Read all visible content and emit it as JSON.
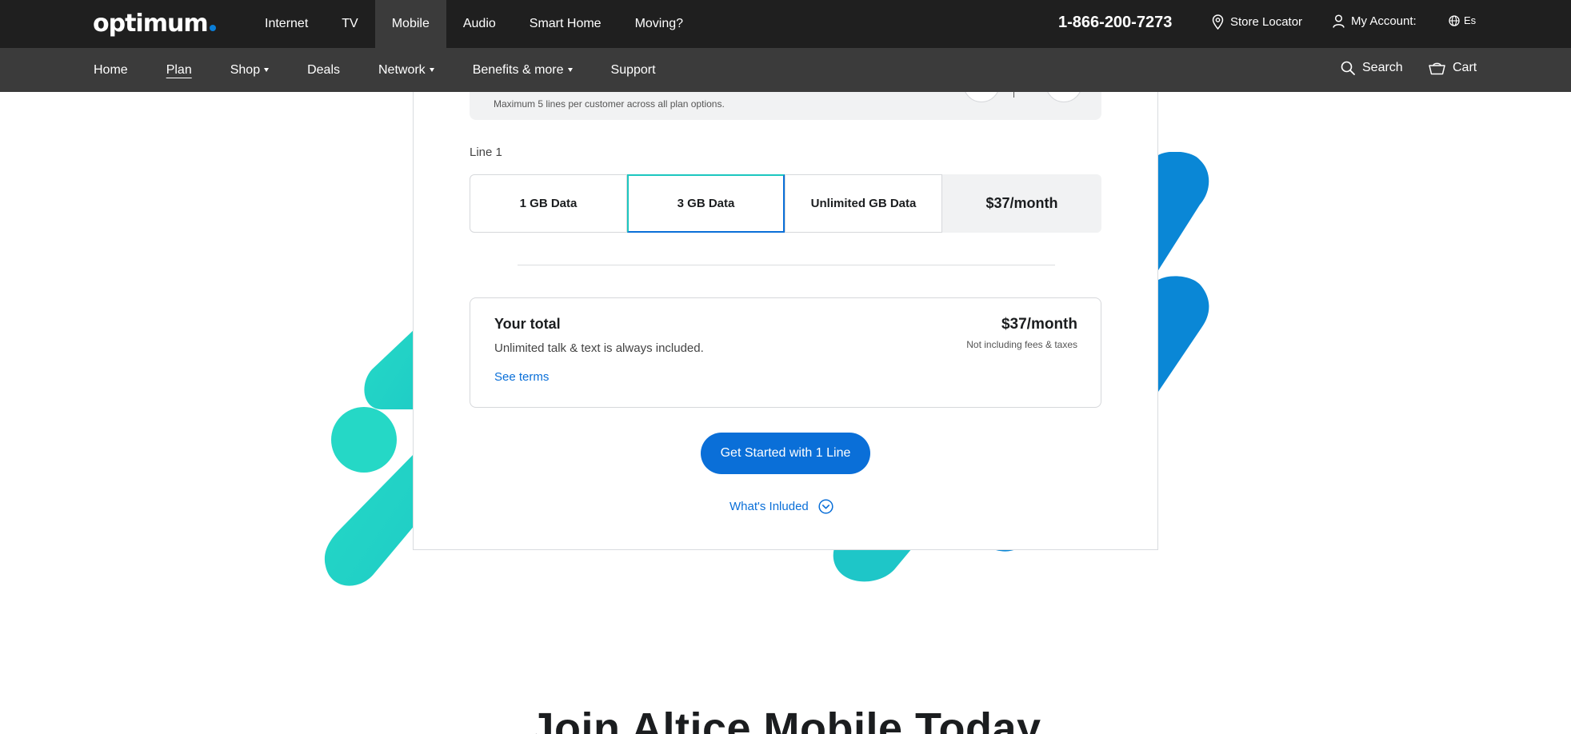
{
  "brand": {
    "logo_text": "optimum",
    "accent": "#0a7ed8"
  },
  "topnav": {
    "items": [
      {
        "label": "Internet"
      },
      {
        "label": "TV"
      },
      {
        "label": "Mobile"
      },
      {
        "label": "Audio"
      },
      {
        "label": "Smart Home"
      },
      {
        "label": "Moving?"
      }
    ],
    "active": "Mobile",
    "phone": "1-866-200-7273",
    "store_locator": "Store Locator",
    "my_account": "My Account:",
    "language": "Es"
  },
  "subnav": {
    "items": [
      {
        "label": "Home"
      },
      {
        "label": "Plan"
      },
      {
        "label": "Shop"
      },
      {
        "label": "Deals"
      },
      {
        "label": "Network"
      },
      {
        "label": "Benefits & more"
      },
      {
        "label": "Support"
      }
    ],
    "current": "Plan",
    "search": "Search",
    "cart": "Cart"
  },
  "plan_builder": {
    "lines_note": "Maximum 5 lines per customer across all plan options.",
    "line_label": "Line 1",
    "options": [
      {
        "label": "1 GB Data",
        "selected": false
      },
      {
        "label": "3 GB Data",
        "selected": true
      },
      {
        "label": "Unlimited GB Data",
        "selected": false
      }
    ],
    "line_price": "$37/month",
    "total": {
      "title": "Your total",
      "subtitle": "Unlimited talk & text is always included.",
      "terms_link": "See terms",
      "price": "$37/month",
      "note": "Not including fees & taxes"
    },
    "cta_label": "Get Started with 1 Line",
    "included_label": "What's Inluded"
  },
  "section_heading": "Join Altice Mobile Today",
  "colors": {
    "top_bar": "#1f1f1f",
    "sub_bar": "#3b3b3b",
    "primary_blue": "#0a6fd8",
    "teal": "#22d3c5"
  },
  "icons": {
    "location": "map-pin-icon",
    "account": "user-icon",
    "language": "globe-icon",
    "search": "search-icon",
    "cart": "cart-icon",
    "expand": "chevron-down-circle-icon"
  }
}
